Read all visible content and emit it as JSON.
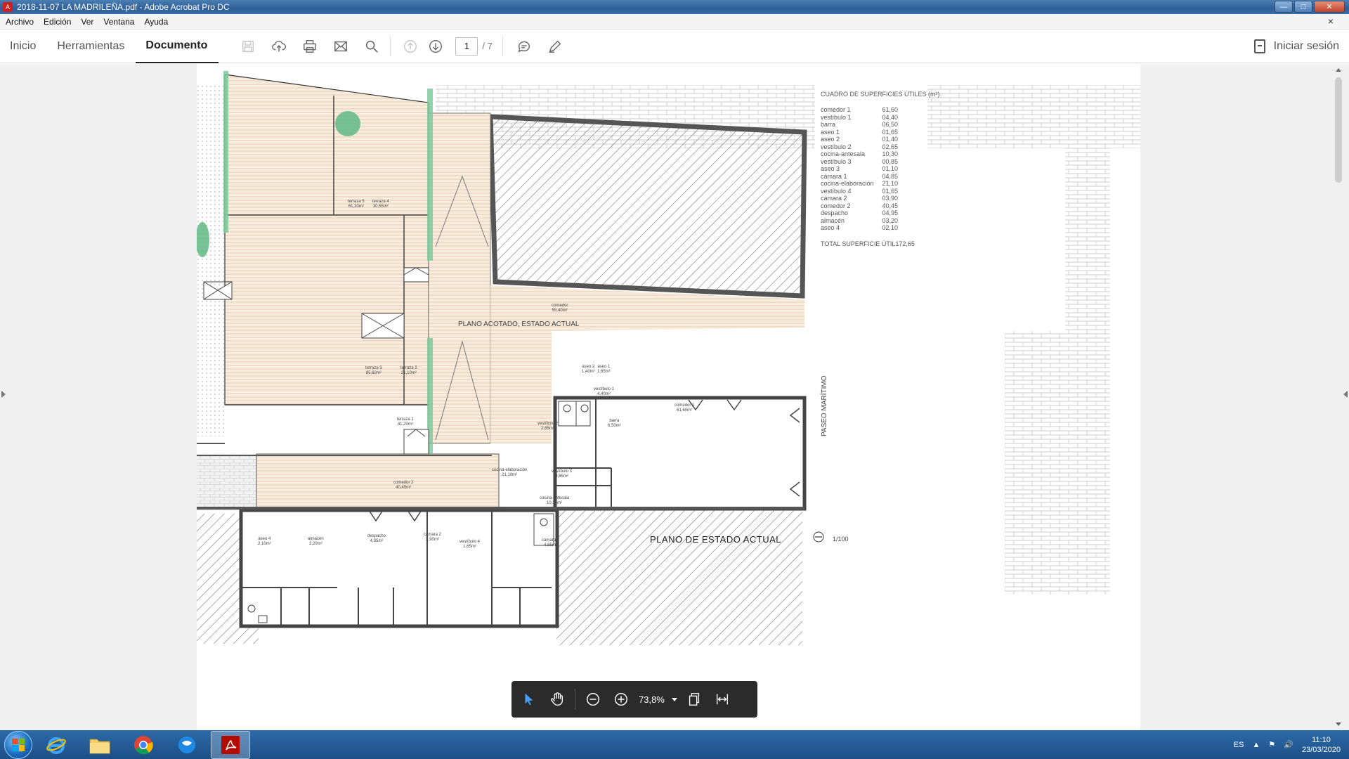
{
  "window": {
    "title": "2018-11-07 LA MADRILEÑA.pdf - Adobe Acrobat Pro DC",
    "buttons": [
      "minimize",
      "maximize",
      "close"
    ]
  },
  "menu": {
    "items": [
      "Archivo",
      "Edición",
      "Ver",
      "Ventana",
      "Ayuda"
    ],
    "close_glyph": "×"
  },
  "toolbar": {
    "tabs": [
      {
        "label": "Inicio",
        "active": false
      },
      {
        "label": "Herramientas",
        "active": false
      },
      {
        "label": "Documento",
        "active": true
      }
    ],
    "tools": [
      "save-icon",
      "upload-icon",
      "print-icon",
      "email-icon",
      "search-icon",
      "page-up-icon",
      "page-down-icon",
      "comment-icon",
      "pen-icon"
    ],
    "page_current": "1",
    "page_total": "/ 7",
    "signin_label": "Iniciar sesión"
  },
  "document": {
    "surface_table": {
      "title": "CUADRO DE SUPERFICIES ÚTILES (m²)",
      "rows": [
        {
          "name": "comedor 1",
          "value": "61,60"
        },
        {
          "name": "vestíbulo 1",
          "value": "04,40"
        },
        {
          "name": "barra",
          "value": "06,50"
        },
        {
          "name": "aseo 1",
          "value": "01,65"
        },
        {
          "name": "aseo 2",
          "value": "01,40"
        },
        {
          "name": "vestíbulo 2",
          "value": "02,65"
        },
        {
          "name": "cocina-antesala",
          "value": "10,30"
        },
        {
          "name": "vestíbulo 3",
          "value": "00,85"
        },
        {
          "name": "aseo 3",
          "value": "01,10"
        },
        {
          "name": "cámara 1",
          "value": "04,85"
        },
        {
          "name": "cocina-elaboración",
          "value": "21,10"
        },
        {
          "name": "vestíbulo 4",
          "value": "01,65"
        },
        {
          "name": "cámara 2",
          "value": "03,90"
        },
        {
          "name": "comedor 2",
          "value": "40,45"
        },
        {
          "name": "despacho",
          "value": "04,95"
        },
        {
          "name": "almacén",
          "value": "03,20"
        },
        {
          "name": "aseo 4",
          "value": "02,10"
        }
      ],
      "total_label": "TOTAL SUPERFICIE ÚTIL",
      "total_value": "172,65"
    },
    "plan_labels": {
      "main": "PLANO ACOTADO, ESTADO ACTUAL",
      "street": "PASEO MARÍTIMO",
      "plan_title": "PLANO DE ESTADO ACTUAL",
      "scale": "1/100"
    },
    "rooms": [
      {
        "label": "terraza 5",
        "area": "61,30m²"
      },
      {
        "label": "terraza 4",
        "area": "30,55m²"
      },
      {
        "label": "terraza 3",
        "area": "85,60m²"
      },
      {
        "label": "terraza 2",
        "area": "21,10m²"
      },
      {
        "label": "terraza 1",
        "area": "41,20m²"
      },
      {
        "label": "comedor",
        "area": "55,40m²"
      },
      {
        "label": "comedor 1",
        "area": "61,60m²"
      },
      {
        "label": "vestíbulo 1",
        "area": "4,40m²"
      },
      {
        "label": "barra",
        "area": "6,50m²"
      },
      {
        "label": "aseo 2",
        "area": "1,40m²"
      },
      {
        "label": "aseo 1",
        "area": "1,65m²"
      },
      {
        "label": "vestíbulo 2",
        "area": "2,65m²"
      },
      {
        "label": "comedor 2",
        "area": "40,45m²"
      },
      {
        "label": "cocina-elaboración",
        "area": "21,10m²"
      },
      {
        "label": "cocina-antesala",
        "area": "10,30m²"
      },
      {
        "label": "vestíbulo 3",
        "area": "0,85m²"
      },
      {
        "label": "aseo 4",
        "area": "2,10m²"
      },
      {
        "label": "almacén",
        "area": "3,20m²"
      },
      {
        "label": "despacho",
        "area": "4,95m²"
      },
      {
        "label": "cámara 2",
        "area": "3,90m²"
      },
      {
        "label": "vestíbulo 4",
        "area": "1,65m²"
      },
      {
        "label": "cámara 1",
        "area": "4,85m²"
      }
    ]
  },
  "floatbar": {
    "tools": [
      "select-icon",
      "hand-icon",
      "zoom-out-icon",
      "zoom-in-icon",
      "page-fit-icon",
      "fit-width-icon"
    ],
    "zoom": "73,8%"
  },
  "taskbar": {
    "apps": [
      "start-button",
      "internet-explorer-icon",
      "file-explorer-icon",
      "chrome-icon",
      "outlook-icon",
      "acrobat-icon"
    ],
    "language": "ES",
    "time": "11:10",
    "date": "23/03/2020"
  },
  "colors": {
    "terrace_fill": "#f6e8d8",
    "terrace_line": "#e8caa8",
    "wall": "#555555",
    "green_planter": "#5fb884",
    "taskbar": "#1c4f86"
  }
}
